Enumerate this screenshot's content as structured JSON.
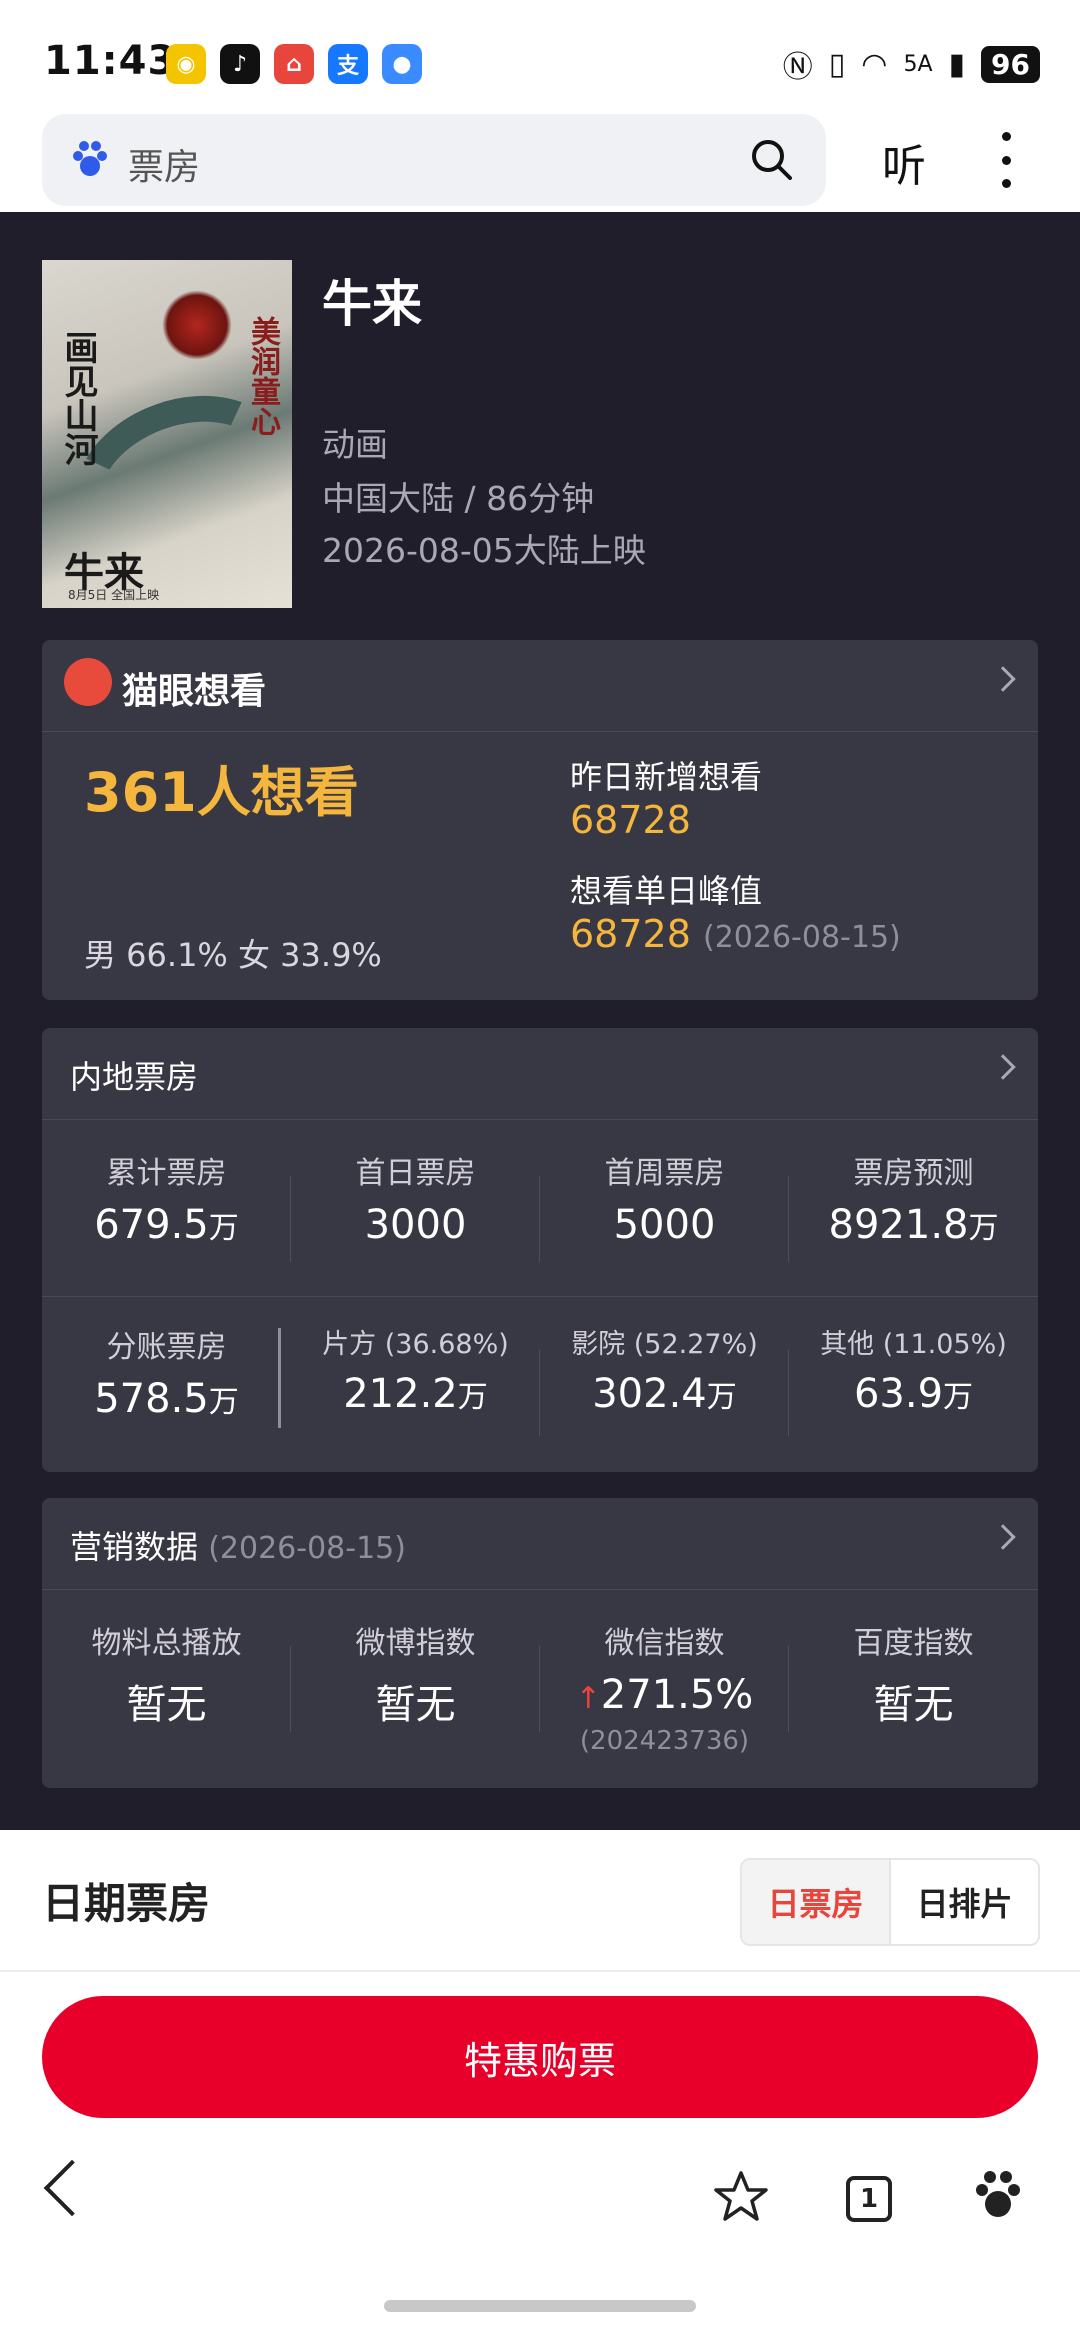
{
  "status_bar": {
    "time": "11:43",
    "battery": "96",
    "network": "5A"
  },
  "search": {
    "query": "票房",
    "listen_label": "听"
  },
  "movie": {
    "title": "牛来",
    "genre": "动画",
    "region_duration": "中国大陆 / 86分钟",
    "release": "2026-08-05大陆上映",
    "poster_text_left": "画见山河",
    "poster_text_right": "美润童心",
    "poster_title": "牛来",
    "poster_release": "8月5日 全国上映"
  },
  "maoyan": {
    "title": "猫眼想看",
    "want_count": "361人想看",
    "gender": "男 66.1% 女 33.9%",
    "new_label": "昨日新增想看",
    "new_value": "68728",
    "peak_label": "想看单日峰值",
    "peak_value": "68728",
    "peak_date": "(2026-08-15)"
  },
  "box_office": {
    "title": "内地票房",
    "row1": [
      {
        "label": "累计票房",
        "value": "679.5",
        "unit": "万"
      },
      {
        "label": "首日票房",
        "value": "3000",
        "unit": ""
      },
      {
        "label": "首周票房",
        "value": "5000",
        "unit": ""
      },
      {
        "label": "票房预测",
        "value": "8921.8",
        "unit": "万"
      }
    ],
    "row2": [
      {
        "label": "分账票房",
        "value": "578.5",
        "unit": "万"
      },
      {
        "label": "片方 (36.68%)",
        "value": "212.2",
        "unit": "万"
      },
      {
        "label": "影院 (52.27%)",
        "value": "302.4",
        "unit": "万"
      },
      {
        "label": "其他 (11.05%)",
        "value": "63.9",
        "unit": "万"
      }
    ]
  },
  "marketing": {
    "title": "营销数据",
    "date": "(2026-08-15)",
    "items": [
      {
        "label": "物料总播放",
        "value": "暂无"
      },
      {
        "label": "微博指数",
        "value": "暂无"
      },
      {
        "label": "微信指数",
        "value": "271.5%",
        "sub": "(202423736)"
      },
      {
        "label": "百度指数",
        "value": "暂无"
      }
    ]
  },
  "date_section": {
    "title": "日期票房",
    "tab_active": "日票房",
    "tab_inactive": "日排片"
  },
  "buy_button": "特惠购票",
  "bottom_nav": {
    "tabs_count": "1"
  },
  "colors": {
    "accent_red": "#e8002a",
    "gold": "#f4b63c",
    "dark_bg": "#1f1e2a",
    "card_bg": "#383744"
  }
}
